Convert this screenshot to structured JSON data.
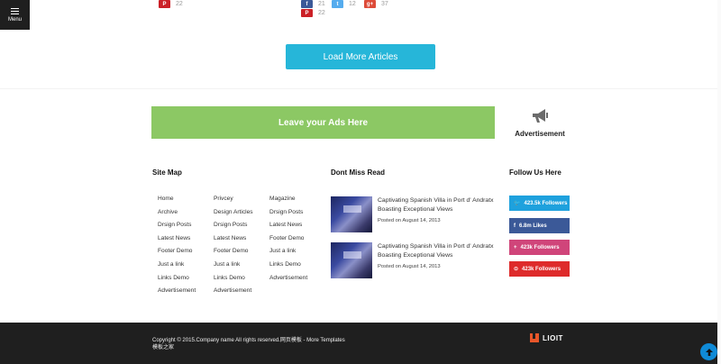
{
  "menu": {
    "label": "Menu"
  },
  "share_counts": {
    "pinterest_left": "22",
    "facebook": "21",
    "twitter": "12",
    "googleplus": "37",
    "pinterest_mid": "22"
  },
  "load_more": {
    "label": "Load More Articles"
  },
  "ads": {
    "banner_text": "Leave your Ads Here",
    "advertisement_label": "Advertisement",
    "icon": "megaphone-icon"
  },
  "sitemap": {
    "title": "Site Map",
    "columns": [
      [
        "Home",
        "Archive",
        "Drsign Posts",
        "Latest News",
        "Footer Demo",
        "Just a link",
        "Links Demo",
        "Advertisement"
      ],
      [
        "Privcey",
        "Design Articles",
        "Drsign Posts",
        "Latest News",
        "Footer Demo",
        "Just a link",
        "Links Demo",
        "Advertisement"
      ],
      [
        "Magazine",
        "Drsign Posts",
        "Latest News",
        "Footer Demo",
        "Just a link",
        "Links Demo",
        "Advertisement"
      ]
    ]
  },
  "dont_miss": {
    "title": "Dont Miss Read",
    "items": [
      {
        "title": "Captivating Spanish Villa in Port d' Andratx Boasting Exceptional Views",
        "date": "Posted on August 14, 2013"
      },
      {
        "title": "Captivating Spanish Villa in Port d' Andratx Boasting Exceptional Views",
        "date": "Posted on August 14, 2013"
      }
    ]
  },
  "follow": {
    "title": "Follow Us Here",
    "buttons": [
      {
        "label": "423.5k Followers",
        "icon": "twitter-icon",
        "color": "#1ea1dd"
      },
      {
        "label": "6.8m Likes",
        "icon": "facebook-icon",
        "color": "#3b5998"
      },
      {
        "label": "423k Followers",
        "icon": "googleplus-icon",
        "color": "#d0457a"
      },
      {
        "label": "423k Followers",
        "icon": "pinterest-icon",
        "color": "#de2b2b"
      }
    ]
  },
  "footer": {
    "copyright_line1": "Copyright © 2015.Company name All rights reserved.网页模板 - More Templates",
    "copyright_line2": "模板之家",
    "logo_text": "LIOIT"
  },
  "colors": {
    "accent": "#26b6d9",
    "ads_green": "#8cc864",
    "footer_bg": "#1f1f1f"
  }
}
